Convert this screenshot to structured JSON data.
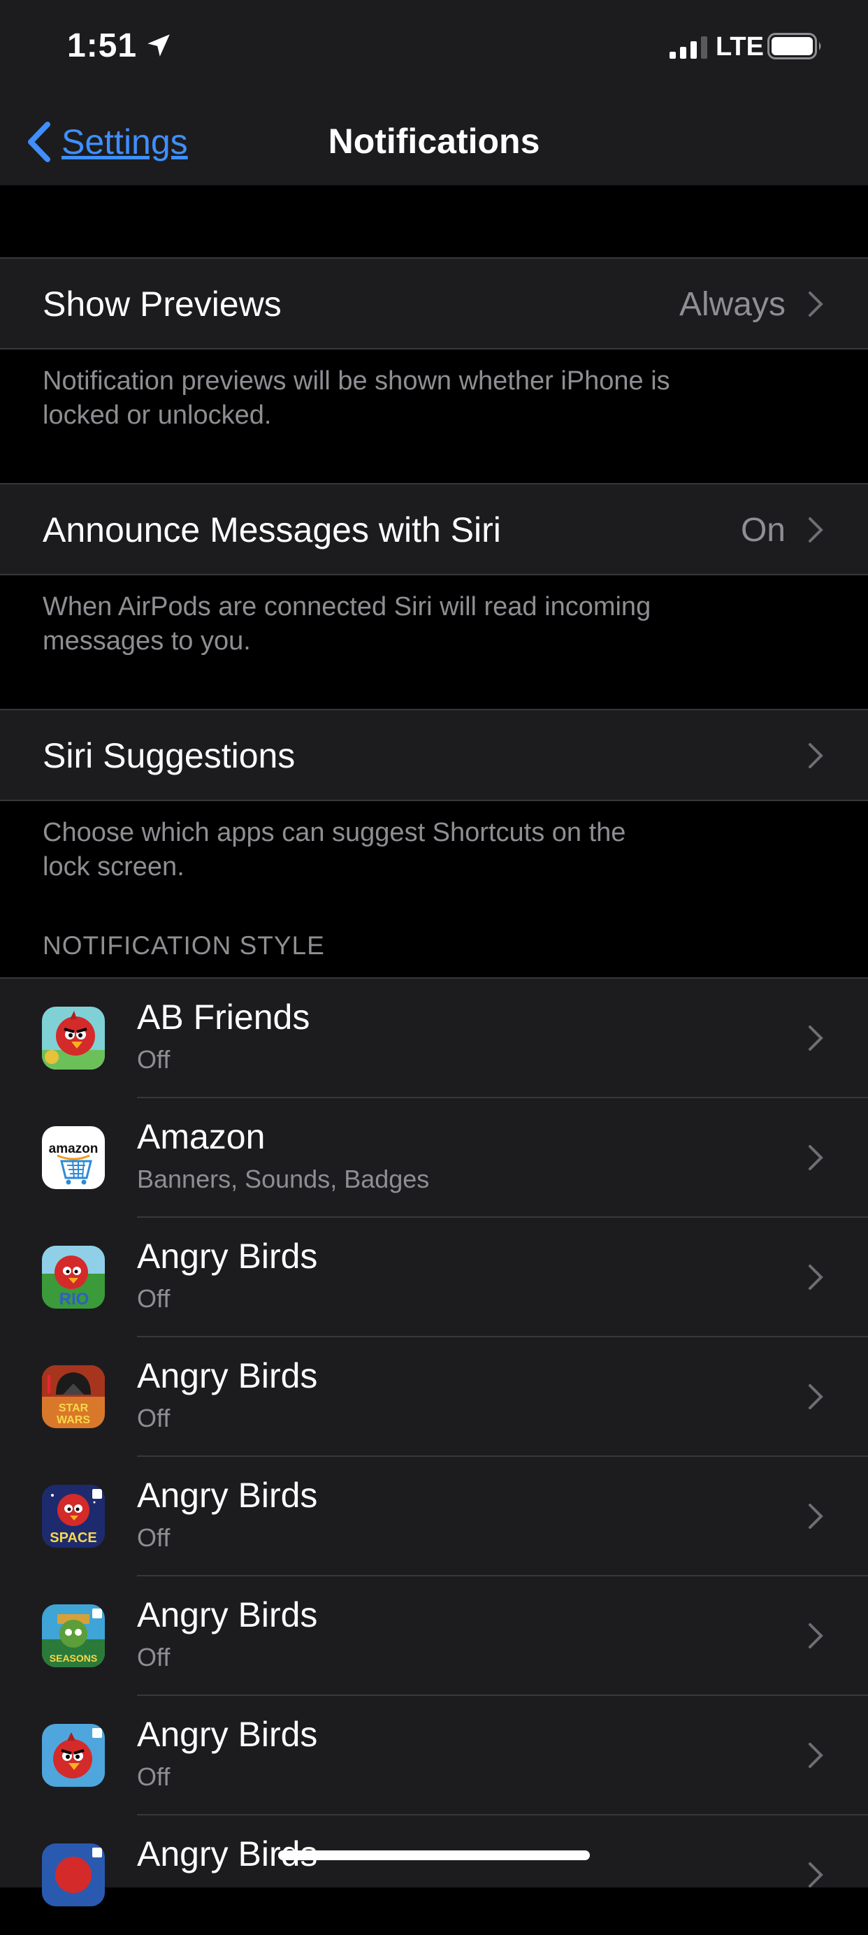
{
  "status": {
    "time": "1:51",
    "network": "LTE",
    "icons": [
      "location-arrow-icon",
      "signal-bars-icon",
      "battery-icon"
    ]
  },
  "nav": {
    "back_label": "Settings",
    "title": "Notifications"
  },
  "settings": [
    {
      "label": "Show Previews",
      "value": "Always",
      "footer": [
        "Notification previews will be shown whether iPhone is",
        "locked or unlocked."
      ]
    },
    {
      "label": "Announce Messages with Siri",
      "value": "On",
      "footer": [
        "When AirPods are connected Siri will read incoming",
        "messages to you."
      ]
    },
    {
      "label": "Siri Suggestions",
      "value": "",
      "footer": [
        "Choose which apps can suggest Shortcuts on the",
        "lock screen."
      ]
    }
  ],
  "section_header": "NOTIFICATION STYLE",
  "apps": [
    {
      "name": "AB Friends",
      "status": "Off",
      "icon": "ab-friends-icon"
    },
    {
      "name": "Amazon",
      "status": "Banners, Sounds, Badges",
      "icon": "amazon-icon"
    },
    {
      "name": "Angry Birds",
      "status": "Off",
      "icon": "angry-birds-rio-icon"
    },
    {
      "name": "Angry Birds",
      "status": "Off",
      "icon": "angry-birds-star-wars-icon"
    },
    {
      "name": "Angry Birds",
      "status": "Off",
      "icon": "angry-birds-space-icon"
    },
    {
      "name": "Angry Birds",
      "status": "Off",
      "icon": "angry-birds-seasons-icon"
    },
    {
      "name": "Angry Birds",
      "status": "Off",
      "icon": "angry-birds-icon"
    },
    {
      "name": "Angry Birds",
      "status": "",
      "icon": "angry-birds-star-wars-2-icon"
    }
  ],
  "colors": {
    "background": "#000000",
    "cell": "#1c1c1e",
    "separator": "#38383a",
    "secondary_text": "#8e8e93",
    "link": "#3f8fff"
  }
}
